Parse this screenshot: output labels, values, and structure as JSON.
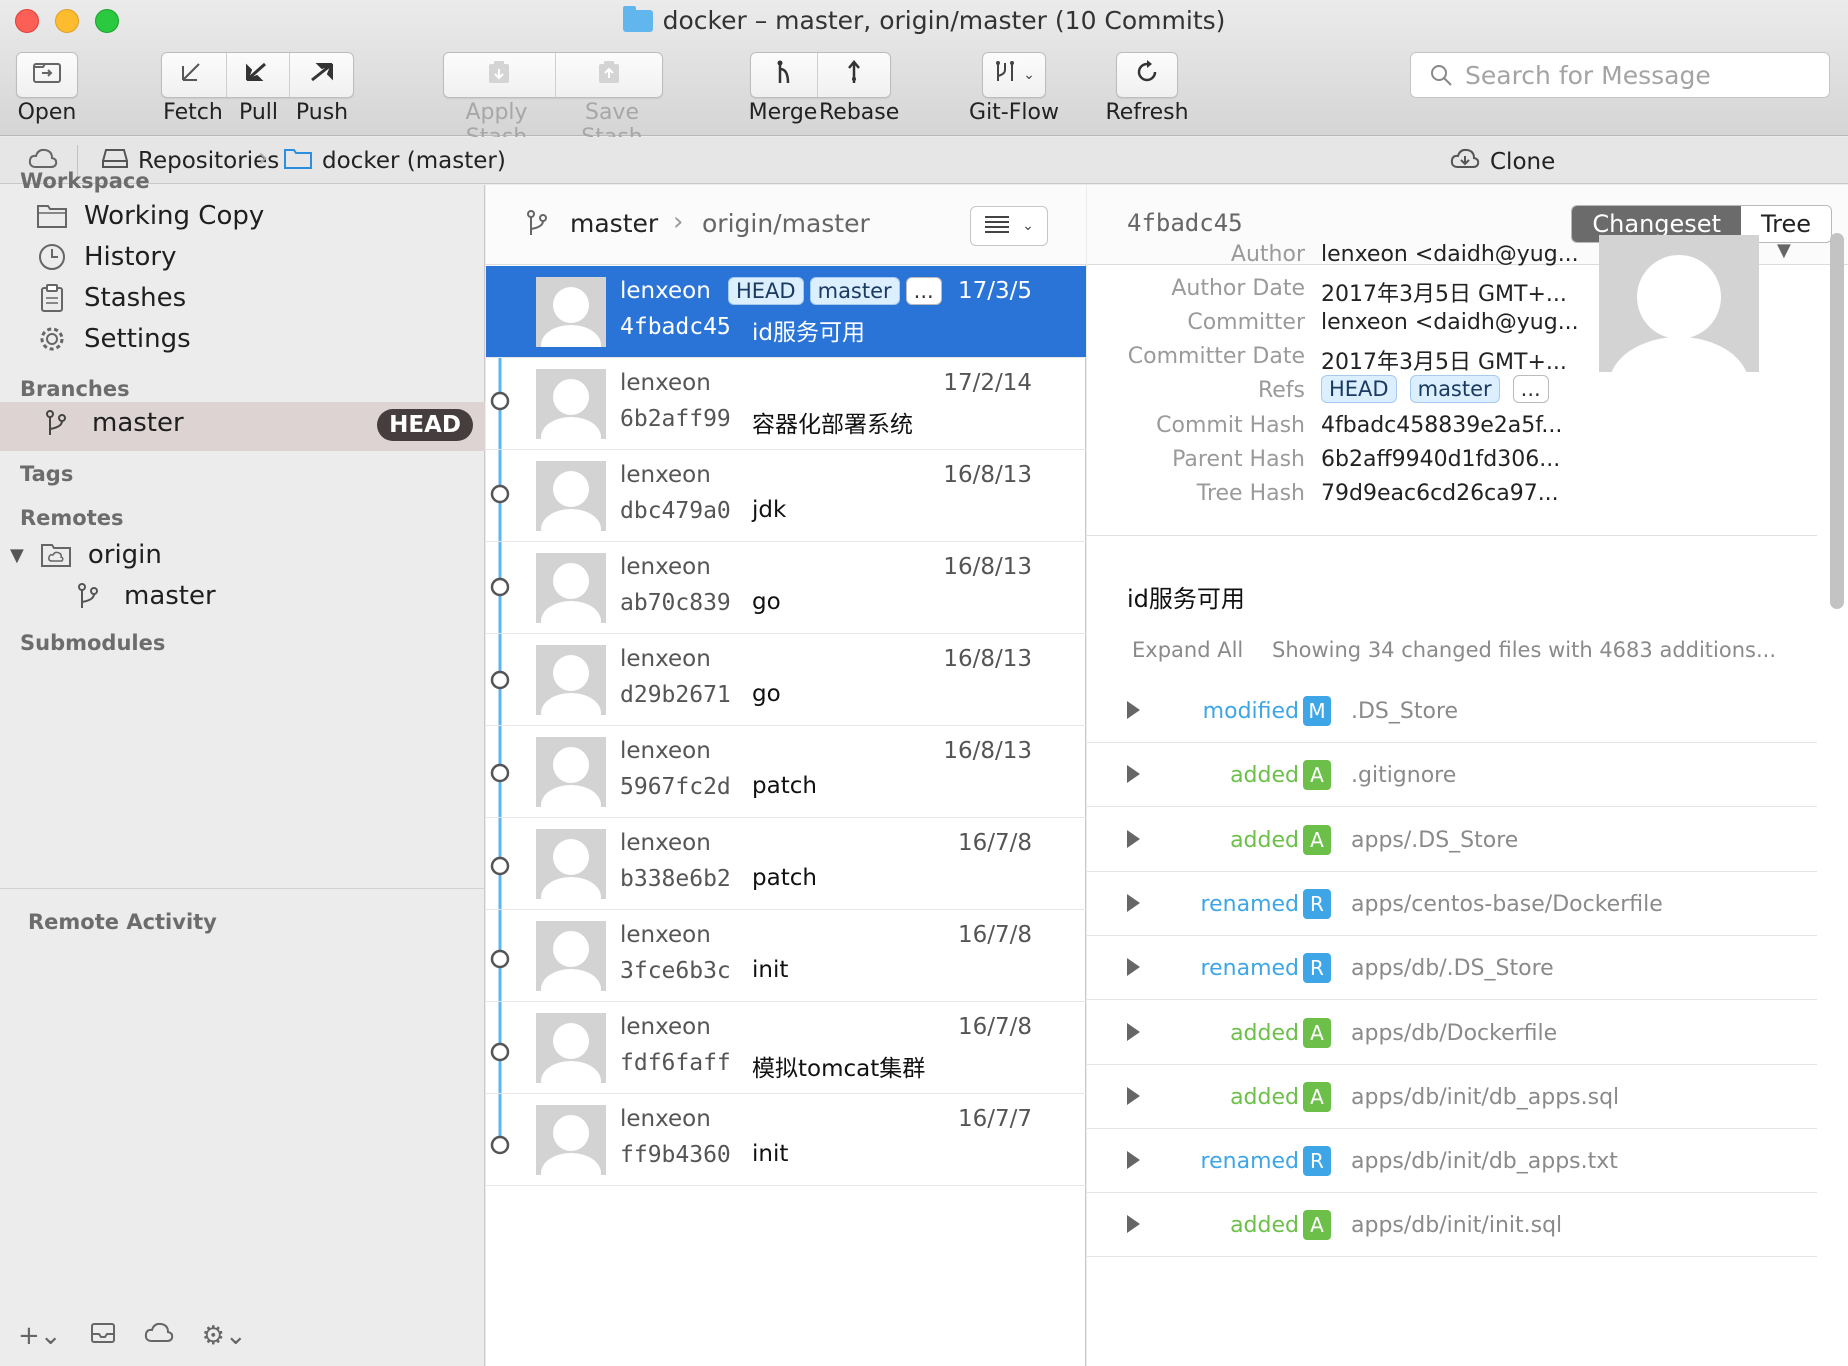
{
  "window": {
    "title": "docker – master, origin/master (10 Commits)"
  },
  "toolbar": {
    "open": "Open",
    "fetch": "Fetch",
    "pull": "Pull",
    "push": "Push",
    "apply_stash": "Apply Stash",
    "save_stash": "Save Stash",
    "merge": "Merge",
    "rebase": "Rebase",
    "gitflow": "Git-Flow",
    "refresh": "Refresh",
    "search_placeholder": "Search for Message"
  },
  "pathbar": {
    "repositories": "Repositories",
    "repo": "docker (master)",
    "clone": "Clone"
  },
  "sidebar": {
    "workspace_header": "Workspace",
    "workspace": [
      "Working Copy",
      "History",
      "Stashes",
      "Settings"
    ],
    "branches_header": "Branches",
    "branch": "master",
    "head_badge": "HEAD",
    "tags_header": "Tags",
    "remotes_header": "Remotes",
    "remote": "origin",
    "remote_branch": "master",
    "submodules_header": "Submodules",
    "remote_activity": "Remote Activity"
  },
  "commits_header": {
    "branch": "master",
    "upstream": "origin/master"
  },
  "commits": [
    {
      "author": "lenxeon",
      "date": "17/3/5",
      "hash": "4fbadc45",
      "message": "id服务可用",
      "tags": [
        "HEAD",
        "master",
        "..."
      ]
    },
    {
      "author": "lenxeon",
      "date": "17/2/14",
      "hash": "6b2aff99",
      "message": "容器化部署系统"
    },
    {
      "author": "lenxeon",
      "date": "16/8/13",
      "hash": "dbc479a0",
      "message": "jdk"
    },
    {
      "author": "lenxeon",
      "date": "16/8/13",
      "hash": "ab70c839",
      "message": "go"
    },
    {
      "author": "lenxeon",
      "date": "16/8/13",
      "hash": "d29b2671",
      "message": "go"
    },
    {
      "author": "lenxeon",
      "date": "16/8/13",
      "hash": "5967fc2d",
      "message": "patch"
    },
    {
      "author": "lenxeon",
      "date": "16/7/8",
      "hash": "b338e6b2",
      "message": "patch"
    },
    {
      "author": "lenxeon",
      "date": "16/7/8",
      "hash": "3fce6b3c",
      "message": "init"
    },
    {
      "author": "lenxeon",
      "date": "16/7/8",
      "hash": "fdf6faff",
      "message": "模拟tomcat集群"
    },
    {
      "author": "lenxeon",
      "date": "16/7/7",
      "hash": "ff9b4360",
      "message": "init"
    }
  ],
  "details": {
    "short_hash": "4fbadc45",
    "tab_changeset": "Changeset",
    "tab_tree": "Tree",
    "labels": {
      "author": "Author",
      "author_date": "Author Date",
      "committer": "Committer",
      "committer_date": "Committer Date",
      "refs": "Refs",
      "commit_hash": "Commit Hash",
      "parent_hash": "Parent Hash",
      "tree_hash": "Tree Hash"
    },
    "values": {
      "author": "lenxeon <daidh@yug...",
      "author_date": "2017年3月5日 GMT+...",
      "committer": "lenxeon <daidh@yug...",
      "committer_date": "2017年3月5日 GMT+...",
      "commit_hash": "4fbadc458839e2a5f...",
      "parent_hash": "6b2aff9940d1fd306...",
      "tree_hash": "79d9eac6cd26ca97..."
    },
    "refs": [
      "HEAD",
      "master",
      "..."
    ],
    "message": "id服务可用",
    "expand_all": "Expand All",
    "summary": "Showing 34 changed files with 4683 additions...",
    "files": [
      {
        "status": "modified",
        "letter": "M",
        "path": ".DS_Store"
      },
      {
        "status": "added",
        "letter": "A",
        "path": ".gitignore"
      },
      {
        "status": "added",
        "letter": "A",
        "path": "apps/.DS_Store"
      },
      {
        "status": "renamed",
        "letter": "R",
        "path": "apps/centos-base/Dockerfile"
      },
      {
        "status": "renamed",
        "letter": "R",
        "path": "apps/db/.DS_Store"
      },
      {
        "status": "added",
        "letter": "A",
        "path": "apps/db/Dockerfile"
      },
      {
        "status": "added",
        "letter": "A",
        "path": "apps/db/init/db_apps.sql"
      },
      {
        "status": "renamed",
        "letter": "R",
        "path": "apps/db/init/db_apps.txt"
      },
      {
        "status": "added",
        "letter": "A",
        "path": "apps/db/init/init.sql"
      }
    ]
  },
  "colors": {
    "selected": "#2a74d8",
    "modified": "#3ea6e6",
    "added": "#6cc04a",
    "renamed": "#3ea6e6",
    "graph": "#5bb5f0"
  }
}
